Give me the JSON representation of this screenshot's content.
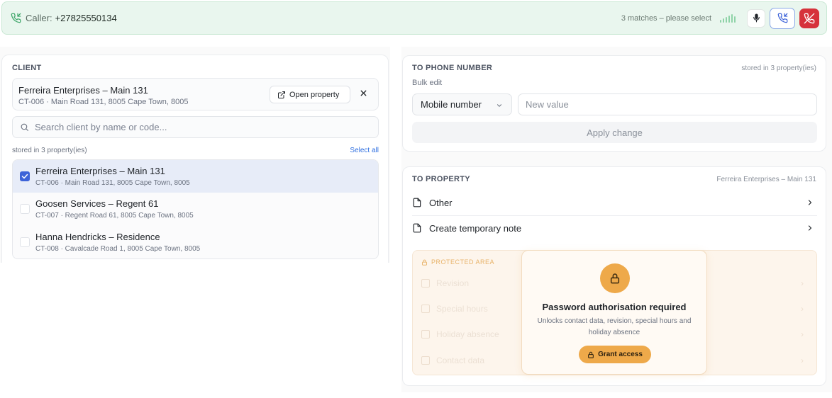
{
  "callbar": {
    "caller_label": "Caller:",
    "caller_number": "+27825550134",
    "matches_text": "3 matches – please select"
  },
  "client": {
    "section_title": "CLIENT",
    "selected": {
      "name": "Ferreira Enterprises – Main 131",
      "sub": "CT-006 · Main Road 131, 8005 Cape Town, 8005",
      "open_property_label": "Open property"
    },
    "search_placeholder": "Search client by name or code...",
    "stored_text": "stored in 3 property(ies)",
    "select_all_label": "Select all",
    "items": [
      {
        "name": "Ferreira Enterprises – Main 131",
        "sub": "CT-006 · Main Road 131, 8005 Cape Town, 8005",
        "checked": true
      },
      {
        "name": "Goosen Services – Regent 61",
        "sub": "CT-007 · Regent Road 61, 8005 Cape Town, 8005",
        "checked": false
      },
      {
        "name": "Hanna Hendricks – Residence",
        "sub": "CT-008 · Cavalcade Road 1, 8005 Cape Town, 8005",
        "checked": false
      }
    ]
  },
  "to_phone": {
    "title": "TO PHONE NUMBER",
    "meta": "stored in 3 property(ies)",
    "bulk_edit": "Bulk edit",
    "select_value": "Mobile number",
    "new_value_placeholder": "New value",
    "apply_label": "Apply change"
  },
  "to_property": {
    "title": "TO PROPERTY",
    "meta": "Ferreira Enterprises – Main 131",
    "items": [
      {
        "label": "Other"
      },
      {
        "label": "Create temporary note"
      }
    ],
    "protected": {
      "label": "PROTECTED AREA",
      "faded_items": [
        "Revision",
        "Special hours",
        "Holiday absence",
        "Contact data"
      ]
    },
    "auth": {
      "title": "Password authorisation required",
      "description": "Unlocks contact data, revision, special hours and holiday absence",
      "grant_label": "Grant access"
    }
  },
  "colors": {
    "callbar_bg": "#e9f6ee",
    "accent_blue": "#3d63d8",
    "hangup_red": "#d6323b",
    "auth_orange": "#eea94a"
  }
}
